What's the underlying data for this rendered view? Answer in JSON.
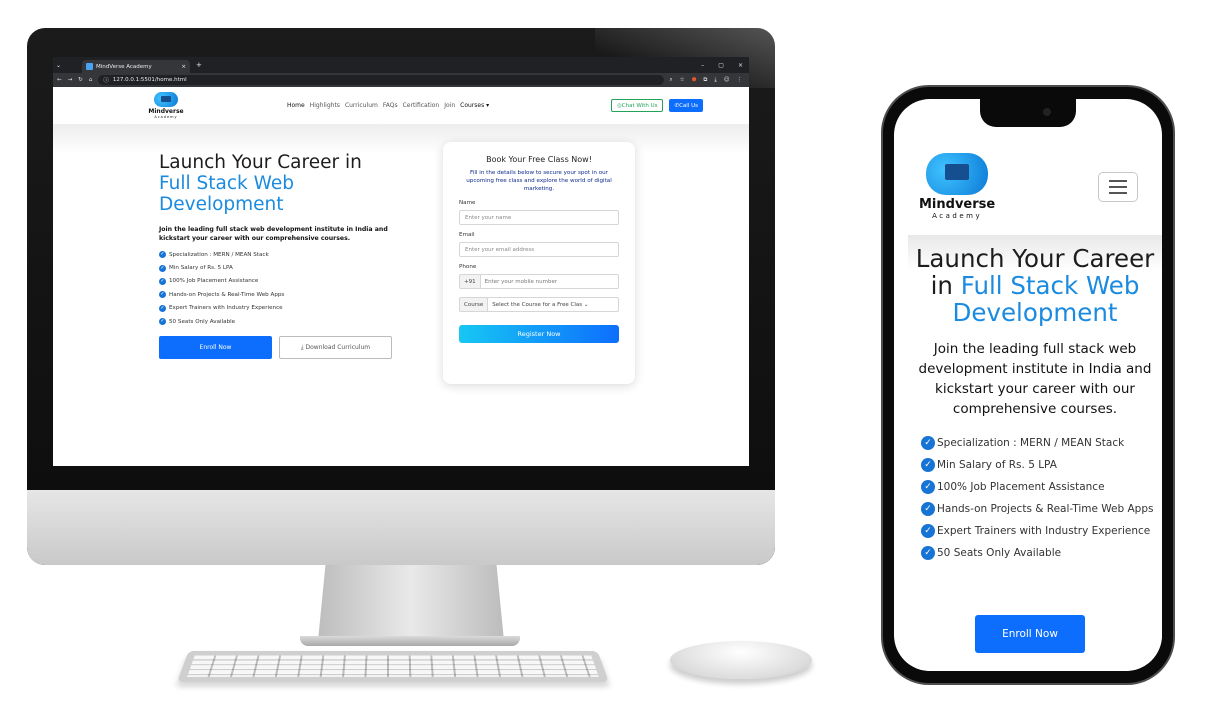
{
  "browser": {
    "tab_title": "MindVerse Academy",
    "tab_close": "×",
    "new_tab": "+",
    "url": "127.0.0.1:5501/home.html",
    "window_controls": [
      "–",
      "▢",
      "×"
    ]
  },
  "brand": {
    "name": "Mindverse",
    "tagline": "Academy"
  },
  "nav": {
    "links": [
      "Home",
      "Highlights",
      "Curriculum",
      "FAQs",
      "Certification",
      "Join",
      "Courses ▾"
    ],
    "chat_label": "Chat With Us",
    "call_label": "Call Us"
  },
  "hero": {
    "title_line1": "Launch Your Career in",
    "title_accent": "Full Stack Web Development",
    "lead": "Join the leading full stack web development institute in India and kickstart your career with our comprehensive courses.",
    "features": [
      "Specialization : MERN / MEAN Stack",
      "Min Salary of Rs. 5 LPA",
      "100% Job Placement Assistance",
      "Hands-on Projects & Real-Time Web Apps",
      "Expert Trainers with Industry Experience",
      "50 Seats Only Available"
    ],
    "enroll_label": "Enroll Now",
    "download_label": "Download Curriculum"
  },
  "form": {
    "title": "Book Your Free Class Now!",
    "subtitle": "Fill in the details below to secure your spot in our upcoming free class and explore the world of digital marketing.",
    "name_label": "Name",
    "name_placeholder": "Enter your name",
    "email_label": "Email",
    "email_placeholder": "Enter your email address",
    "phone_label": "Phone",
    "phone_prefix": "+91",
    "phone_placeholder": "Enter your mobile number",
    "course_prefix": "Course",
    "course_select": "Select the Course for a Free Clas",
    "register_label": "Register Now"
  },
  "mobile": {
    "title_line1": "Launch Your Career in",
    "title_accent": "Full Stack Web Development",
    "enroll_label": "Enroll Now"
  },
  "colors": {
    "accent": "#1a8be0",
    "primary": "#0d6efd",
    "chat_green": "#21a35a"
  }
}
